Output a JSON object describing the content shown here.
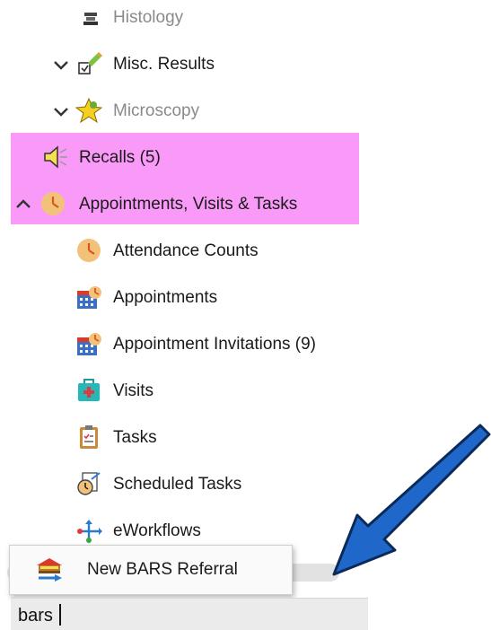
{
  "tree": {
    "histology": "Histology",
    "misc_results": "Misc. Results",
    "microscopy": "Microscopy",
    "recalls": "Recalls (5)",
    "appointments_group": "Appointments, Visits & Tasks",
    "children": {
      "attendance_counts": "Attendance Counts",
      "appointments": "Appointments",
      "appointment_invitations": "Appointment Invitations (9)",
      "visits": "Visits",
      "tasks": "Tasks",
      "scheduled_tasks": "Scheduled Tasks",
      "eworkflows": "eWorkflows"
    }
  },
  "popup": {
    "item": "New BARS Referral"
  },
  "search": {
    "value": "bars"
  },
  "colors": {
    "highlight": "#f99af8",
    "arrow": "#1f68c9"
  }
}
